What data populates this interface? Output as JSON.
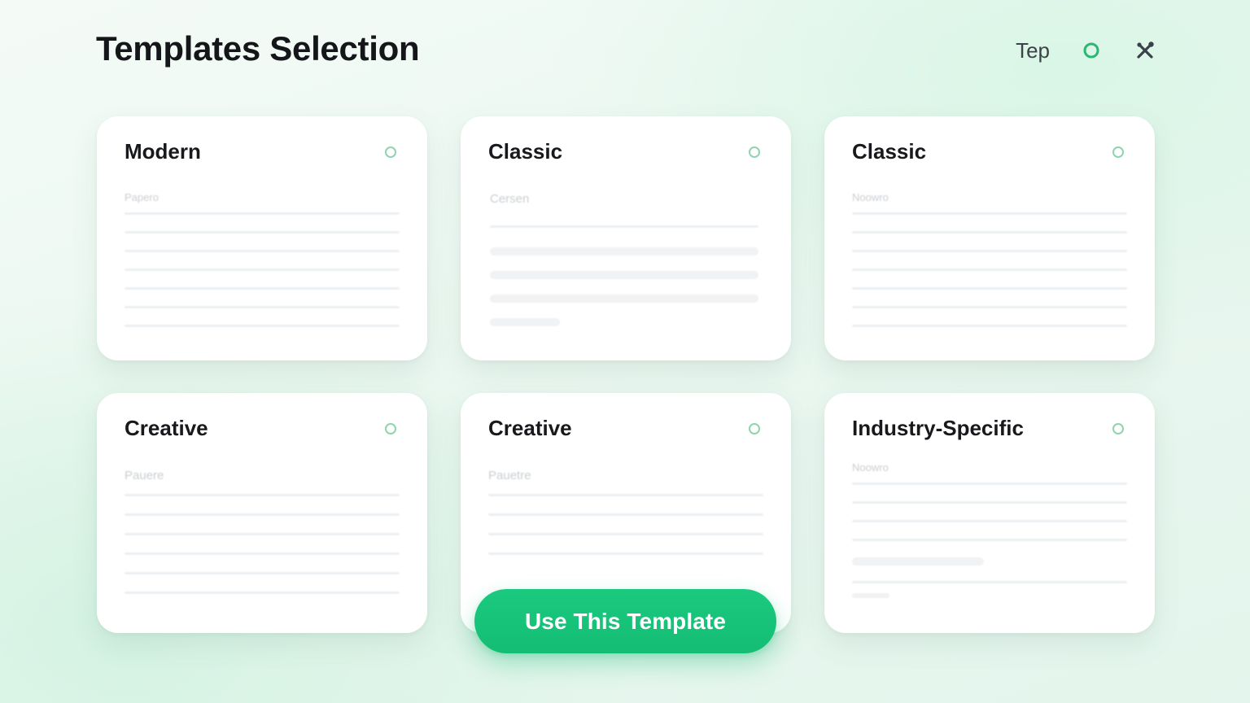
{
  "page": {
    "title": "Templates Selection"
  },
  "header": {
    "label": "Tep",
    "icons": [
      "ring-icon",
      "tools-icon"
    ]
  },
  "colors": {
    "accent": "#15c27a",
    "ring": "#2bb673",
    "radio": "#8fd4ae",
    "icon_dark": "#3a4047"
  },
  "templates": [
    {
      "title": "Modern",
      "preview_label": "Papero"
    },
    {
      "title": "Classic",
      "preview_label": "Cersen"
    },
    {
      "title": "Classic",
      "preview_label": "Noowro"
    },
    {
      "title": "Creative",
      "preview_label": "Pauere"
    },
    {
      "title": "Creative",
      "preview_label": "Pauetre"
    },
    {
      "title": "Industry-Specific",
      "preview_label": "Noowro"
    }
  ],
  "cta": {
    "label": "Use This Template"
  }
}
